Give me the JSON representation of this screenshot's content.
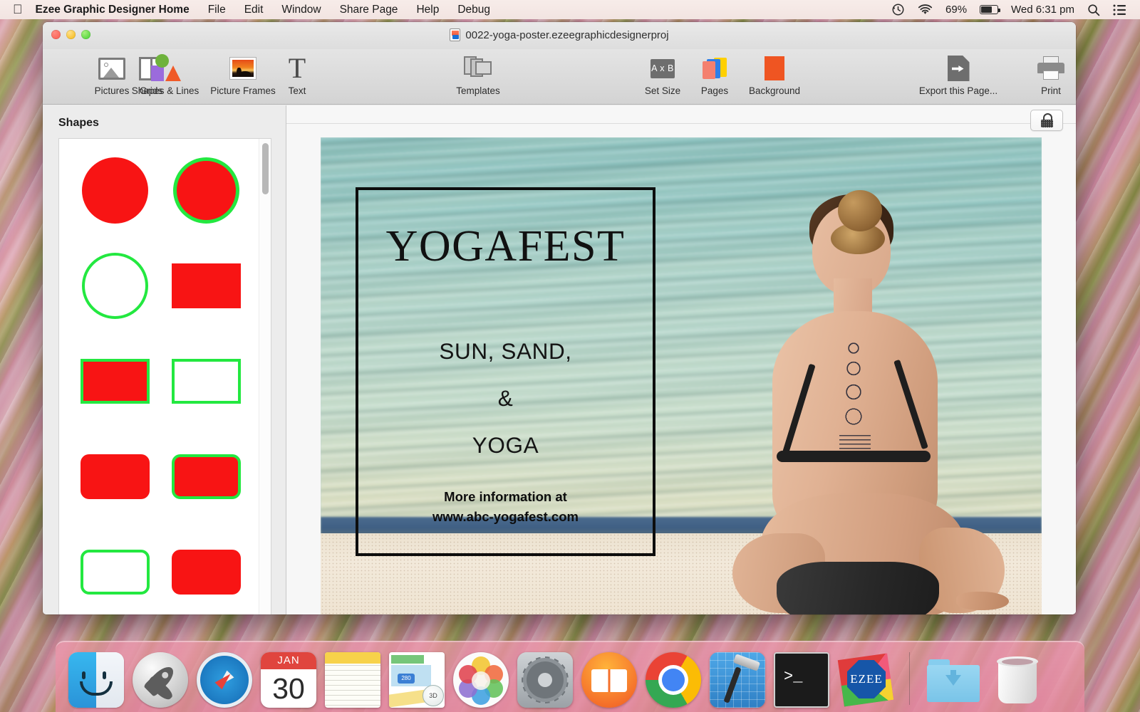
{
  "menubar": {
    "apple_icon": "apple-logo",
    "app_name": "Ezee Graphic Designer Home",
    "menus": [
      "File",
      "Edit",
      "Window",
      "Share Page",
      "Help",
      "Debug"
    ],
    "status": {
      "time_machine_icon": "time-machine-icon",
      "wifi_icon": "wifi-icon",
      "battery_percent": "69%",
      "battery_icon": "battery-icon",
      "datetime": "Wed 6:31 pm",
      "search_icon": "search-icon",
      "notification_icon": "notification-center-icon"
    }
  },
  "window": {
    "document_title": "0022-yoga-poster.ezeegraphicdesignerproj",
    "document_icon": "project-file-icon",
    "traffic_lights": {
      "close": "close-button",
      "minimize": "minimize-button",
      "zoom": "zoom-button"
    },
    "toolbar": [
      {
        "label": "Pictures",
        "icon": "pictures-icon"
      },
      {
        "label": "Grids",
        "icon": "grids-icon"
      },
      {
        "label": "Shapes & Lines",
        "icon": "shapes-and-lines-icon"
      },
      {
        "label": "Picture Frames",
        "icon": "picture-frames-icon"
      },
      {
        "label": "Text",
        "icon": "text-icon"
      },
      {
        "label": "Templates",
        "icon": "templates-icon"
      },
      {
        "label": "Set Size",
        "icon": "set-size-icon",
        "icon_text": "A x B"
      },
      {
        "label": "Pages",
        "icon": "pages-icon"
      },
      {
        "label": "Background",
        "icon": "background-icon"
      },
      {
        "label": "Export this Page...",
        "icon": "export-page-icon"
      },
      {
        "label": "Print",
        "icon": "print-icon"
      }
    ]
  },
  "sidebar": {
    "title": "Shapes",
    "shapes": [
      {
        "name": "filled-circle",
        "fill": "#f81414",
        "stroke": "none"
      },
      {
        "name": "filled-circle-outlined",
        "fill": "#f81414",
        "stroke": "#23e840"
      },
      {
        "name": "outlined-circle",
        "fill": "#ffffff",
        "stroke": "#23e840"
      },
      {
        "name": "filled-rectangle",
        "fill": "#f81414",
        "stroke": "none"
      },
      {
        "name": "filled-rectangle-outlined",
        "fill": "#f81414",
        "stroke": "#23e840"
      },
      {
        "name": "outlined-rectangle",
        "fill": "#ffffff",
        "stroke": "#23e840"
      },
      {
        "name": "filled-rounded-rectangle",
        "fill": "#f81414",
        "stroke": "none"
      },
      {
        "name": "filled-rounded-rectangle-outlined",
        "fill": "#f81414",
        "stroke": "#23e840"
      },
      {
        "name": "outlined-rounded-rectangle",
        "fill": "#ffffff",
        "stroke": "#23e840"
      },
      {
        "name": "filled-rounded-rectangle-2",
        "fill": "#f81414",
        "stroke": "none"
      }
    ]
  },
  "canvas": {
    "lock_button_icon": "unlocked-padlock-icon",
    "poster": {
      "title": "YOGAFEST",
      "subtitle_lines": [
        "SUN, SAND,",
        "&",
        "YOGA"
      ],
      "footer_lines": [
        "More information at",
        "www.abc-yogafest.com"
      ],
      "frame_color": "#0d0d0d",
      "photo_description": "woman-sitting-on-beach-photo"
    }
  },
  "dock": {
    "items": [
      {
        "name": "finder",
        "label": "Finder"
      },
      {
        "name": "launchpad",
        "label": "Launchpad"
      },
      {
        "name": "safari",
        "label": "Safari"
      },
      {
        "name": "calendar",
        "label": "Calendar",
        "header": "JAN",
        "day": "30"
      },
      {
        "name": "notes",
        "label": "Notes"
      },
      {
        "name": "maps",
        "label": "Maps",
        "badge": "3D",
        "shield": "280"
      },
      {
        "name": "photos",
        "label": "Photos"
      },
      {
        "name": "system-preferences",
        "label": "System Preferences"
      },
      {
        "name": "ibooks",
        "label": "iBooks"
      },
      {
        "name": "chrome",
        "label": "Google Chrome"
      },
      {
        "name": "xcode",
        "label": "Xcode"
      },
      {
        "name": "terminal",
        "label": "Terminal",
        "prompt": ">_"
      },
      {
        "name": "ezee-graphic-designer",
        "label": "Ezee Graphic Designer",
        "badge_text": "EZEE"
      },
      {
        "name": "downloads-folder",
        "label": "Downloads"
      },
      {
        "name": "trash",
        "label": "Trash"
      }
    ]
  }
}
